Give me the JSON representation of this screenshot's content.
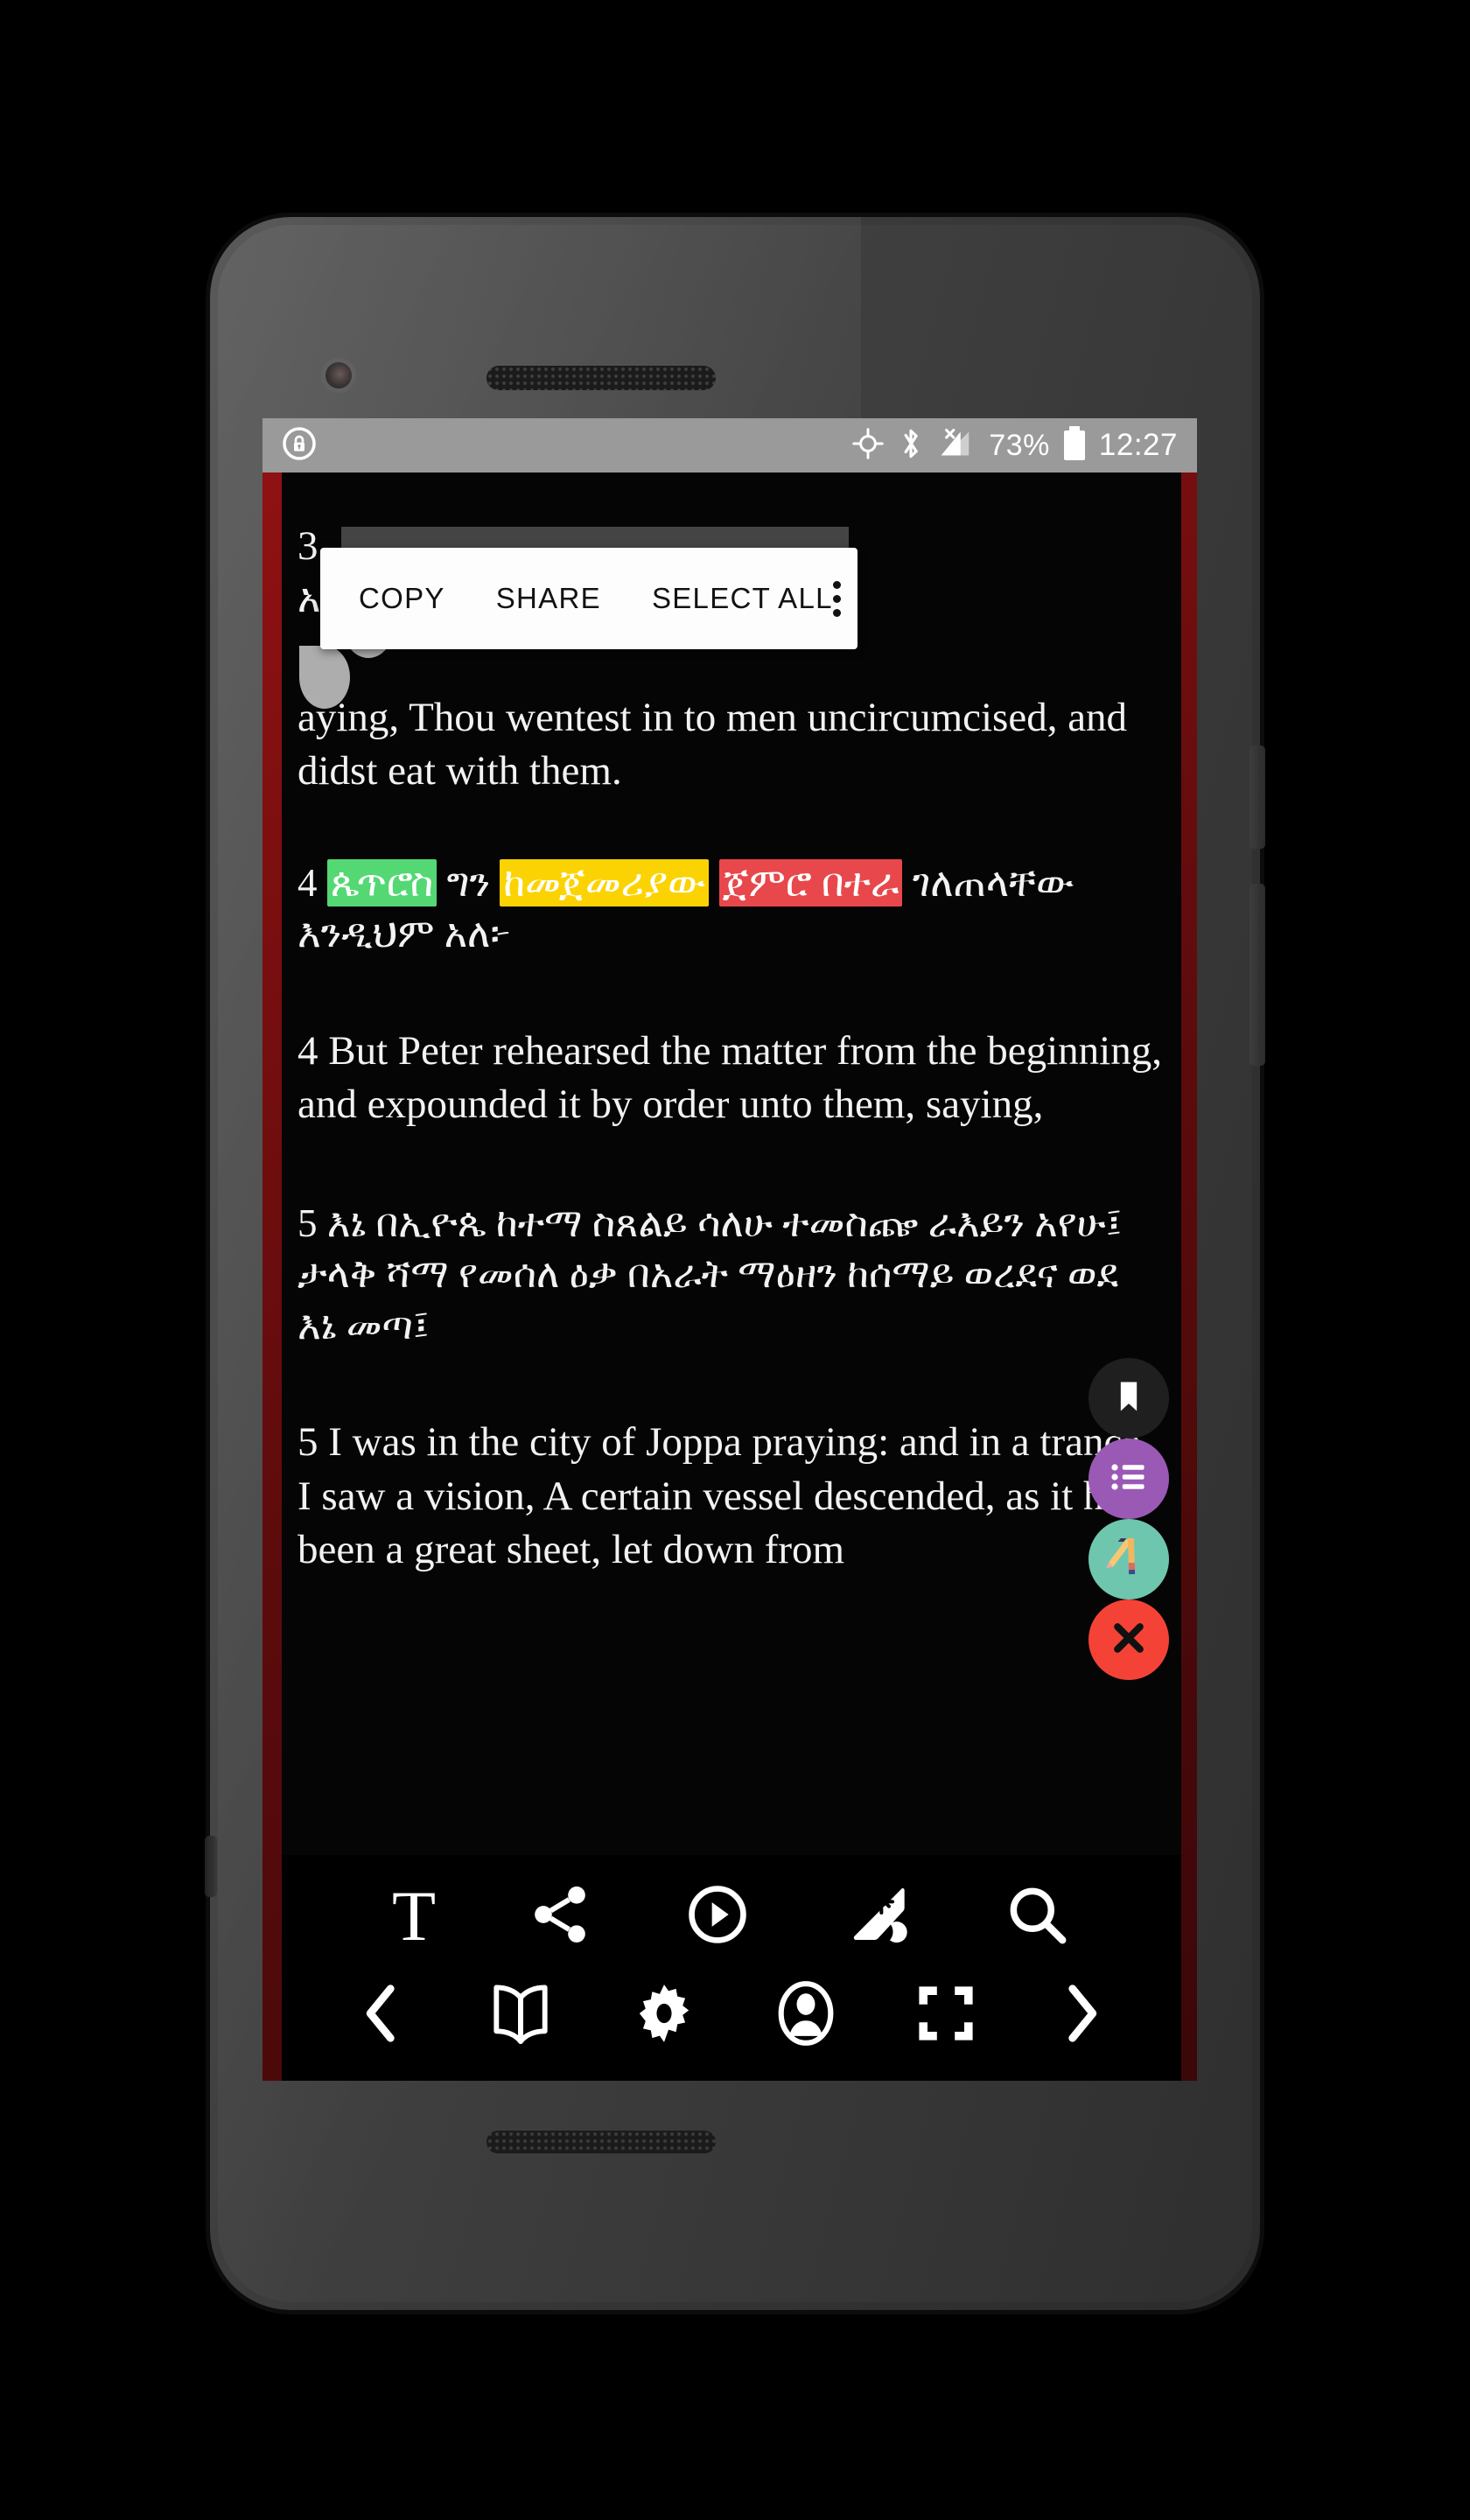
{
  "status_bar": {
    "lock_icon": "lock-circle-icon",
    "gps_icon": "gps-icon",
    "bluetooth_icon": "bluetooth-icon",
    "signal_icon": "signal-no-service-icon",
    "battery_percent": "73%",
    "battery_icon": "battery-icon",
    "time": "12:27"
  },
  "context_action_bar": {
    "copy": "COPY",
    "share": "SHARE",
    "select_all": "SELECT ALL",
    "overflow_icon": "overflow-menu-icon"
  },
  "reader": {
    "verse3_amharic_tail": "3",
    "verse3_amharic_line2": "አሉት።",
    "verse3_english": "aying, Thou wentest in to men uncircumcised, and didst eat with them.",
    "verse4_amharic": {
      "number": "4",
      "seg_green": "ጴጥሮስ",
      "seg_plain1": "ግን",
      "seg_yellow": "ከመጀመሪያው",
      "seg_red": "ጀምሮ በተራ",
      "seg_plain2": "ገለጠላቸው እንዲህም አለ፦"
    },
    "verse4_english": "4 But Peter rehearsed the matter from the beginning, and expounded it by order unto them, saying,",
    "verse5_amharic": "5 እኔ በኢዮጴ ከተማ ስጸልይ ሳለሁ ተመስጬ ራእይን አየሁ፤ ታላቅ ሻማ የመሰለ ዕቃ በአራት ማዕዘን ከሰማይ ወረደና ወደ እኔ መጣ፤",
    "verse5_english": "5 I was in the city of Joppa praying: and in a trance I saw a vision, A certain vessel descended, as it had been a great sheet, let down from"
  },
  "fabs": [
    {
      "name": "bookmark-fab",
      "icon": "bookmark-icon",
      "color": "#1f1f1f"
    },
    {
      "name": "list-fab",
      "icon": "list-icon",
      "color": "#9b59b6"
    },
    {
      "name": "highlight-fab",
      "icon": "pencil-brush-icon",
      "color": "#6fc6ae"
    },
    {
      "name": "close-fab",
      "icon": "close-x-icon",
      "color": "#f44336"
    }
  ],
  "toolbar": {
    "row1": [
      {
        "name": "text-settings-button",
        "icon": "text-T-icon",
        "glyph": "T"
      },
      {
        "name": "share-button",
        "icon": "share-nodes-icon"
      },
      {
        "name": "play-audio-button",
        "icon": "play-circle-icon"
      },
      {
        "name": "theme-button",
        "icon": "day-night-theme-icon"
      },
      {
        "name": "search-button",
        "icon": "search-icon"
      }
    ],
    "row2": [
      {
        "name": "previous-chapter-button",
        "icon": "chevron-left-icon"
      },
      {
        "name": "book-button",
        "icon": "open-book-icon"
      },
      {
        "name": "settings-button",
        "icon": "gear-icon"
      },
      {
        "name": "profile-button",
        "icon": "user-circle-icon"
      },
      {
        "name": "fullscreen-button",
        "icon": "fullscreen-icon"
      },
      {
        "name": "next-chapter-button",
        "icon": "chevron-right-icon"
      }
    ]
  },
  "colors": {
    "frame_red": "#7d0f10",
    "highlight_green": "#54d873",
    "highlight_yellow": "#fcd302",
    "highlight_red": "#e8484b",
    "fab_purple": "#9b59b6",
    "fab_teal": "#6fc6ae",
    "fab_close_red": "#f44336",
    "statusbar_grey": "#9a9a9a"
  }
}
